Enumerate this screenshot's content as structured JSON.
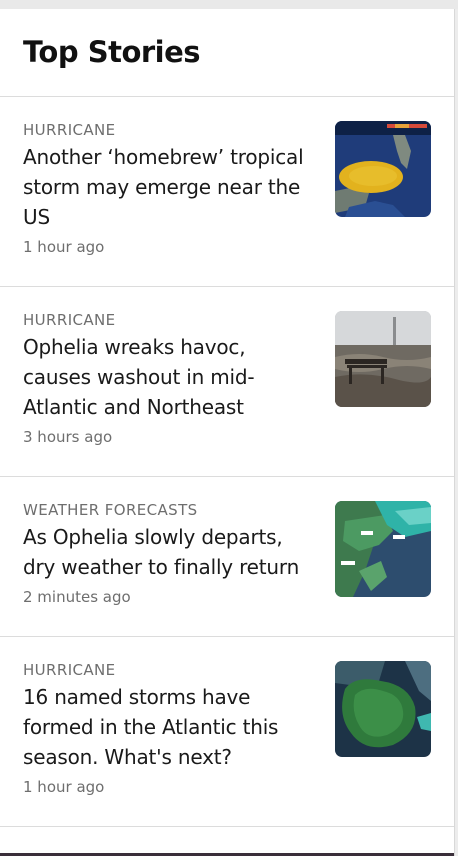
{
  "section": {
    "title": "Top Stories"
  },
  "stories": [
    {
      "category": "HURRICANE",
      "headline": "Another ‘homebrew’ tropical storm may emerge near the US",
      "time": "1 hour ago",
      "thumb_icon": "tropical-outlook-map"
    },
    {
      "category": "HURRICANE",
      "headline": "Ophelia wreaks havoc, causes washout in mid-Atlantic and Northeast",
      "time": "3 hours ago",
      "thumb_icon": "flooded-bench-photo"
    },
    {
      "category": "WEATHER FORECASTS",
      "headline": "As Ophelia slowly departs, dry weather to finally return",
      "time": "2 minutes ago",
      "thumb_icon": "east-coast-forecast-map"
    },
    {
      "category": "HURRICANE",
      "headline": "16 named storms have formed in the Atlantic this season. What's next?",
      "time": "1 hour ago",
      "thumb_icon": "atlantic-storms-map"
    }
  ]
}
